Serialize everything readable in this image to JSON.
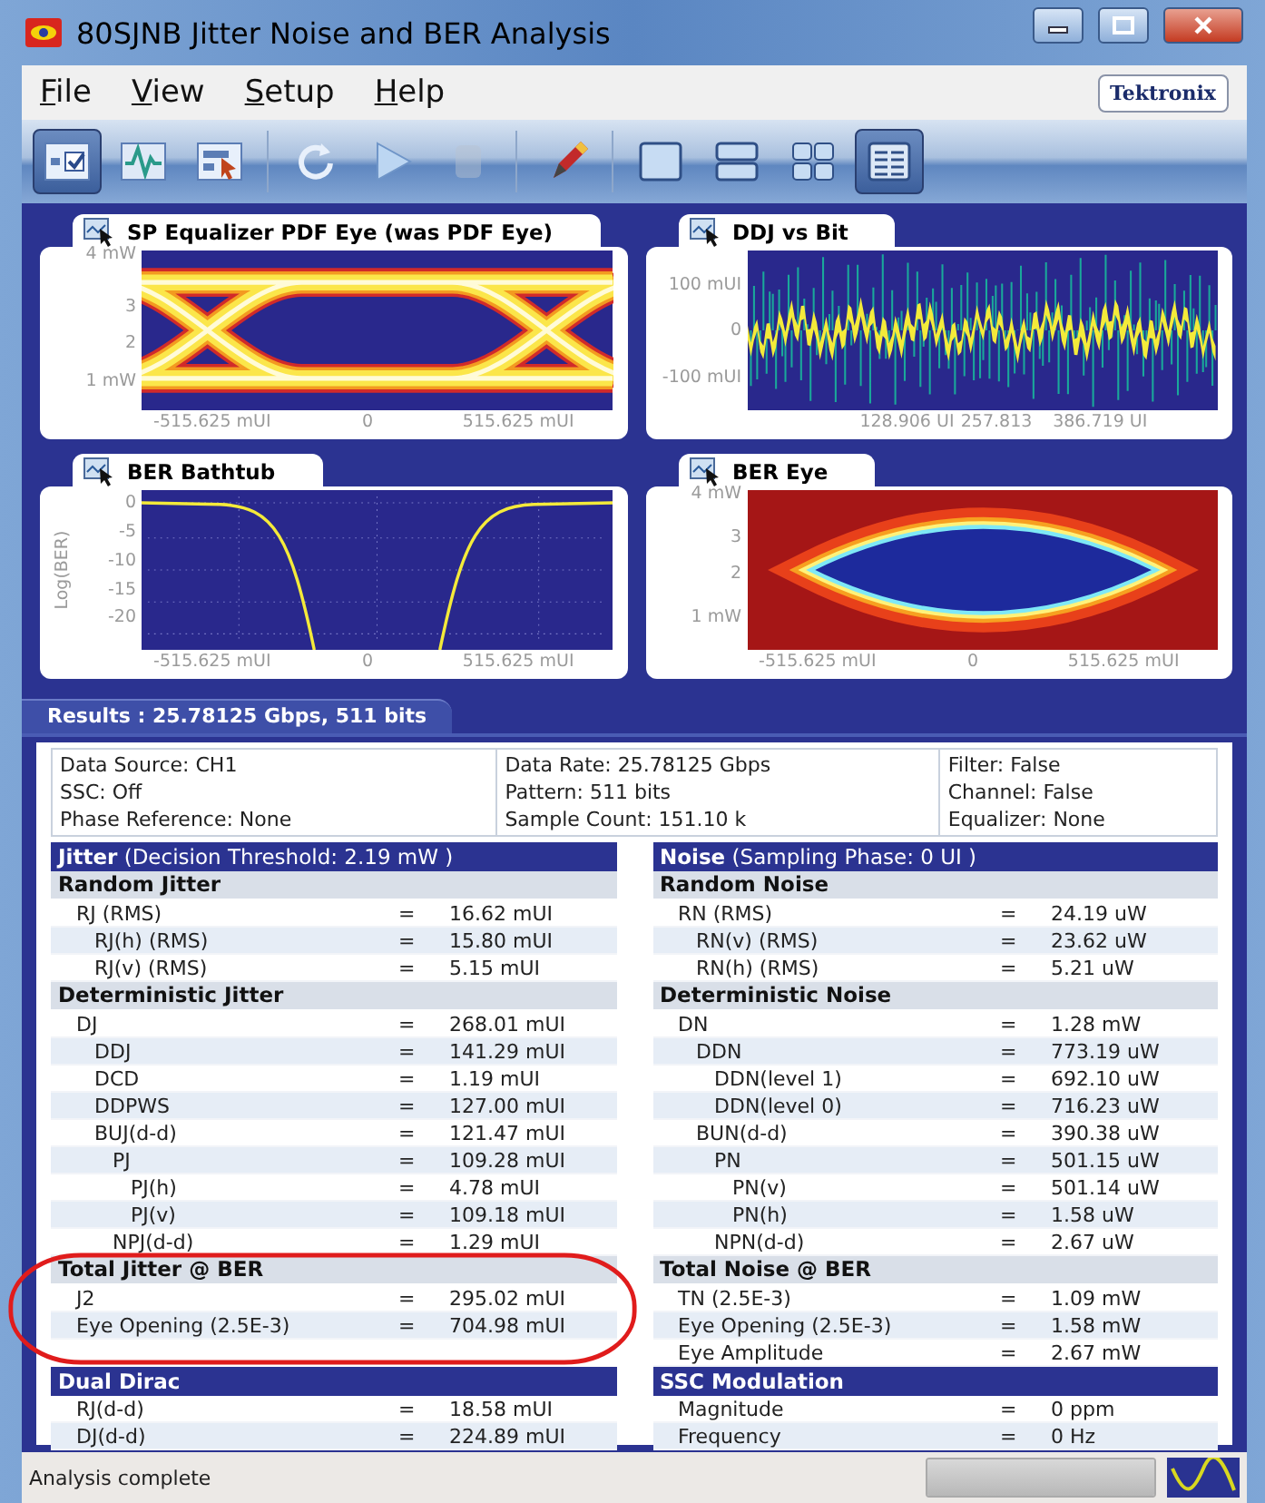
{
  "window": {
    "title": "80SJNB Jitter Noise and BER Analysis"
  },
  "menu": [
    {
      "label": "File"
    },
    {
      "label": "View"
    },
    {
      "label": "Setup"
    },
    {
      "label": "Help"
    }
  ],
  "brand": "Tektronix",
  "toolbar": [
    {
      "kind": "checklist",
      "selected": true,
      "disabled": false
    },
    {
      "kind": "waveform",
      "selected": false,
      "disabled": false
    },
    {
      "kind": "pointer",
      "selected": false,
      "disabled": false
    },
    {
      "kind": "refresh",
      "selected": false,
      "disabled": false
    },
    {
      "kind": "run",
      "selected": false,
      "disabled": false
    },
    {
      "kind": "stop",
      "selected": false,
      "disabled": true
    },
    {
      "kind": "pencil",
      "selected": false,
      "disabled": false
    },
    {
      "kind": "single",
      "selected": false,
      "disabled": false
    },
    {
      "kind": "split",
      "selected": false,
      "disabled": false
    },
    {
      "kind": "quad",
      "selected": false,
      "disabled": false
    },
    {
      "kind": "table",
      "selected": true,
      "disabled": false
    }
  ],
  "plots": [
    {
      "kind": "pdf-eye",
      "title": "SP Equalizer PDF Eye (was PDF Eye)",
      "yticks": [
        "4 mW",
        "3",
        "2",
        "1 mW"
      ],
      "xticks": [
        "-515.625 mUI",
        "0",
        "515.625 mUI"
      ]
    },
    {
      "kind": "ddj",
      "title": "DDJ vs Bit",
      "yticks": [
        "100 mUI",
        "0",
        "-100 mUI"
      ],
      "xticks": [
        "128.906 UI",
        "257.813",
        "386.719 UI"
      ]
    },
    {
      "kind": "bathtub",
      "title": "BER Bathtub",
      "ylabel": "Log(BER)",
      "yticks": [
        "0",
        "-5",
        "-10",
        "-15",
        "-20"
      ],
      "xticks": [
        "-515.625 mUI",
        "0",
        "515.625 mUI"
      ]
    },
    {
      "kind": "ber-eye",
      "title": "BER Eye",
      "yticks": [
        "4 mW",
        "3",
        "2",
        "1 mW"
      ],
      "xticks": [
        "-515.625 mUI",
        "0",
        "515.625 mUI"
      ]
    }
  ],
  "results": {
    "tab": "Results : 25.78125 Gbps, 511 bits",
    "info": [
      [
        "Data Source: CH1",
        "SSC: Off",
        "Phase Reference: None"
      ],
      [
        "Data Rate: 25.78125 Gbps",
        "Pattern: 511 bits",
        "Sample Count: 151.10 k"
      ],
      [
        "Filter: False",
        "Channel: False",
        "Equalizer: None"
      ]
    ]
  },
  "jitter": {
    "header": "**Jitter** (Decision Threshold: 2.19 mW )",
    "sections": [
      {
        "title": "Random Jitter",
        "highlight": false,
        "rows": [
          {
            "label": "RJ (RMS)",
            "op": "=",
            "value": "16.62 mUI",
            "children": [
              {
                "label": "RJ(h) (RMS)",
                "op": "=",
                "value": "15.80 mUI"
              },
              {
                "label": "RJ(v) (RMS)",
                "op": "=",
                "value": "5.15 mUI"
              }
            ]
          }
        ]
      },
      {
        "title": "Deterministic Jitter",
        "highlight": false,
        "rows": [
          {
            "label": "DJ",
            "op": "=",
            "value": "268.01 mUI",
            "children": [
              {
                "label": "DDJ",
                "op": "=",
                "value": "141.29 mUI"
              },
              {
                "label": "DCD",
                "op": "=",
                "value": "1.19 mUI"
              },
              {
                "label": "DDPWS",
                "op": "=",
                "value": "127.00 mUI"
              },
              {
                "label": "BUJ(d-d)",
                "op": "=",
                "value": "121.47 mUI",
                "children": [
                  {
                    "label": "PJ",
                    "op": "=",
                    "value": "109.28 mUI",
                    "children": [
                      {
                        "label": "PJ(h)",
                        "op": "=",
                        "value": "4.78 mUI"
                      },
                      {
                        "label": "PJ(v)",
                        "op": "=",
                        "value": "109.18 mUI"
                      }
                    ]
                  },
                  {
                    "label": "NPJ(d-d)",
                    "op": "=",
                    "value": "1.29 mUI"
                  }
                ]
              }
            ]
          }
        ]
      },
      {
        "title": "Total Jitter @ BER",
        "highlight": true,
        "rows": [
          {
            "label": "J2",
            "op": "=",
            "value": "295.02 mUI"
          },
          {
            "label": "Eye Opening (2.5E-3)",
            "op": "=",
            "value": "704.98 mUI"
          }
        ]
      }
    ],
    "bottom": {
      "title": "Dual Dirac",
      "rows": [
        {
          "label": "RJ(d-d)",
          "op": "=",
          "value": "18.58 mUI"
        },
        {
          "label": "DJ(d-d)",
          "op": "=",
          "value": "224.89 mUI"
        }
      ]
    }
  },
  "noise": {
    "header": "**Noise** (Sampling Phase: 0 UI )",
    "sections": [
      {
        "title": "Random Noise",
        "highlight": false,
        "rows": [
          {
            "label": "RN (RMS)",
            "op": "=",
            "value": "24.19 uW",
            "children": [
              {
                "label": "RN(v) (RMS)",
                "op": "=",
                "value": "23.62 uW"
              },
              {
                "label": "RN(h) (RMS)",
                "op": "=",
                "value": "5.21 uW"
              }
            ]
          }
        ]
      },
      {
        "title": "Deterministic Noise",
        "highlight": false,
        "rows": [
          {
            "label": "DN",
            "op": "=",
            "value": "1.28 mW",
            "children": [
              {
                "label": "DDN",
                "op": "=",
                "value": "773.19 uW",
                "children": [
                  {
                    "label": "DDN(level 1)",
                    "op": "=",
                    "value": "692.10 uW"
                  },
                  {
                    "label": "DDN(level 0)",
                    "op": "=",
                    "value": "716.23 uW"
                  }
                ]
              },
              {
                "label": "BUN(d-d)",
                "op": "=",
                "value": "390.38 uW",
                "children": [
                  {
                    "label": "PN",
                    "op": "=",
                    "value": "501.15 uW",
                    "children": [
                      {
                        "label": "PN(v)",
                        "op": "=",
                        "value": "501.14 uW"
                      },
                      {
                        "label": "PN(h)",
                        "op": "=",
                        "value": "1.58 uW"
                      }
                    ]
                  },
                  {
                    "label": "NPN(d-d)",
                    "op": "=",
                    "value": "2.67 uW"
                  }
                ]
              }
            ]
          }
        ]
      },
      {
        "title": "Total Noise @ BER",
        "highlight": false,
        "rows": [
          {
            "label": "TN (2.5E-3)",
            "op": "=",
            "value": "1.09 mW"
          },
          {
            "label": "Eye Opening (2.5E-3)",
            "op": "=",
            "value": "1.58 mW"
          },
          {
            "label": "Eye Amplitude",
            "op": "=",
            "value": "2.67 mW"
          }
        ]
      }
    ],
    "bottom": {
      "title": "SSC Modulation",
      "rows": [
        {
          "label": "Magnitude",
          "op": "=",
          "value": "0 ppm"
        },
        {
          "label": "Frequency",
          "op": "=",
          "value": "0 Hz"
        }
      ]
    }
  },
  "status": {
    "text": "Analysis complete",
    "progress": {
      "level": 1
    }
  }
}
